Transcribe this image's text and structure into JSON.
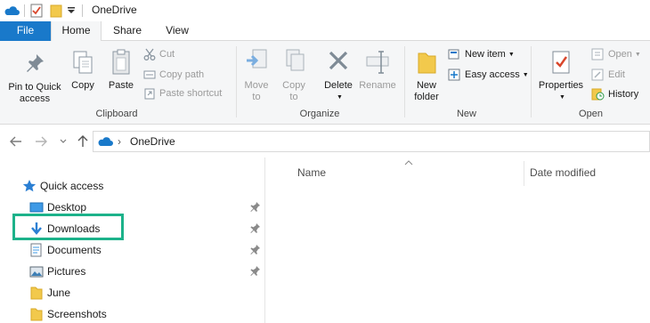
{
  "window": {
    "title": "OneDrive"
  },
  "tabs": [
    {
      "label": "File"
    },
    {
      "label": "Home"
    },
    {
      "label": "Share"
    },
    {
      "label": "View"
    }
  ],
  "ribbon": {
    "clipboard": {
      "label": "Clipboard",
      "pin_to_quick_access": "Pin to Quick access",
      "copy": "Copy",
      "paste": "Paste",
      "cut": "Cut",
      "copy_path": "Copy path",
      "paste_shortcut": "Paste shortcut"
    },
    "organize": {
      "label": "Organize",
      "move_to": "Move to",
      "copy_to": "Copy to",
      "delete": "Delete",
      "rename": "Rename"
    },
    "new": {
      "label": "New",
      "new_folder": "New folder",
      "new_item": "New item",
      "easy_access": "Easy access"
    },
    "open": {
      "label": "Open",
      "properties": "Properties",
      "open": "Open",
      "edit": "Edit",
      "history": "History"
    }
  },
  "address": {
    "crumb": "OneDrive"
  },
  "navigation": {
    "quick_access": "Quick access",
    "items": [
      {
        "label": "Desktop",
        "pinned": true
      },
      {
        "label": "Downloads",
        "pinned": true
      },
      {
        "label": "Documents",
        "pinned": true
      },
      {
        "label": "Pictures",
        "pinned": true
      },
      {
        "label": "June",
        "pinned": false
      },
      {
        "label": "Screenshots",
        "pinned": false
      }
    ]
  },
  "columns": [
    {
      "label": "Name"
    },
    {
      "label": "Date modified"
    }
  ],
  "colors": {
    "accent": "#1979ca",
    "highlight": "#1cb28a",
    "folder": "#f2c94c"
  }
}
